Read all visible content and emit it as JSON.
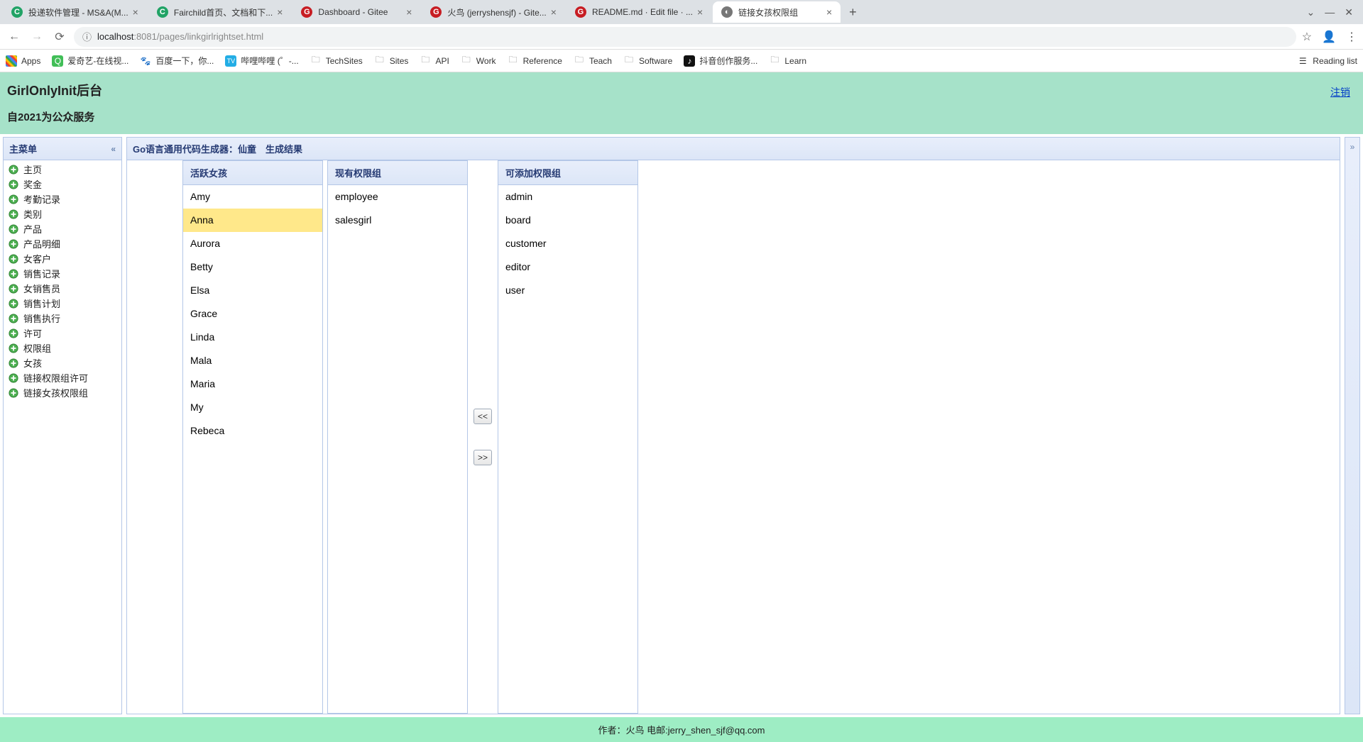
{
  "browser": {
    "tabs": [
      {
        "title": "投递软件管理 - MS&A(M...",
        "favicon": "C",
        "favcolor": "#21a366"
      },
      {
        "title": "Fairchild首页、文档和下...",
        "favicon": "C",
        "favcolor": "#21a366"
      },
      {
        "title": "Dashboard - Gitee",
        "favicon": "G",
        "favcolor": "#c71d23"
      },
      {
        "title": "火鸟 (jerryshensjf) - Gite...",
        "favicon": "G",
        "favcolor": "#c71d23"
      },
      {
        "title": "README.md · Edit file · ...",
        "favicon": "G",
        "favcolor": "#c71d23"
      },
      {
        "title": "链接女孩权限组",
        "favicon": "◐",
        "favcolor": "#777",
        "active": true
      }
    ],
    "new_tab": "+",
    "url_host": "localhost",
    "url_port": ":8081",
    "url_path": "/pages/linkgirlrightset.html",
    "bookmarks": [
      {
        "label": "Apps",
        "icon": "apps"
      },
      {
        "label": "爱奇艺-在线视...",
        "icon": "iqiyi"
      },
      {
        "label": "百度一下，你...",
        "icon": "baidu"
      },
      {
        "label": "哔哩哔哩 (゜-...",
        "icon": "bili"
      },
      {
        "label": "TechSites",
        "icon": "folder"
      },
      {
        "label": "Sites",
        "icon": "folder"
      },
      {
        "label": "API",
        "icon": "folder"
      },
      {
        "label": "Work",
        "icon": "folder"
      },
      {
        "label": "Reference",
        "icon": "folder"
      },
      {
        "label": "Teach",
        "icon": "folder"
      },
      {
        "label": "Software",
        "icon": "folder"
      },
      {
        "label": "抖音创作服务...",
        "icon": "douyin"
      },
      {
        "label": "Learn",
        "icon": "folder"
      }
    ],
    "reading_list": "Reading list"
  },
  "page": {
    "title1": "GirlOnlyInit后台",
    "title2": "自2021为公众服务",
    "logout": "注销",
    "sidebar_title": "主菜单",
    "sidebar_items": [
      "主页",
      "奖金",
      "考勤记录",
      "类别",
      "产品",
      "产品明细",
      "女客户",
      "销售记录",
      "女销售员",
      "销售计划",
      "销售执行",
      "许可",
      "权限组",
      "女孩",
      "链接权限组许可",
      "链接女孩权限组"
    ],
    "main_title": "Go语言通用代码生成器：仙童　生成结果",
    "lists": {
      "girls": {
        "title": "活跃女孩",
        "items": [
          "Amy",
          "Anna",
          "Aurora",
          "Betty",
          "Elsa",
          "Grace",
          "Linda",
          "Mala",
          "Maria",
          "My",
          "Rebeca"
        ],
        "selected_index": 1
      },
      "current": {
        "title": "现有权限组",
        "items": [
          "employee",
          "salesgirl"
        ]
      },
      "available": {
        "title": "可添加权限组",
        "items": [
          "admin",
          "board",
          "customer",
          "editor",
          "user"
        ]
      }
    },
    "transfer": {
      "left": "<<",
      "right": ">>"
    },
    "footer": "作者：火鸟 电邮:jerry_shen_sjf@qq.com"
  }
}
